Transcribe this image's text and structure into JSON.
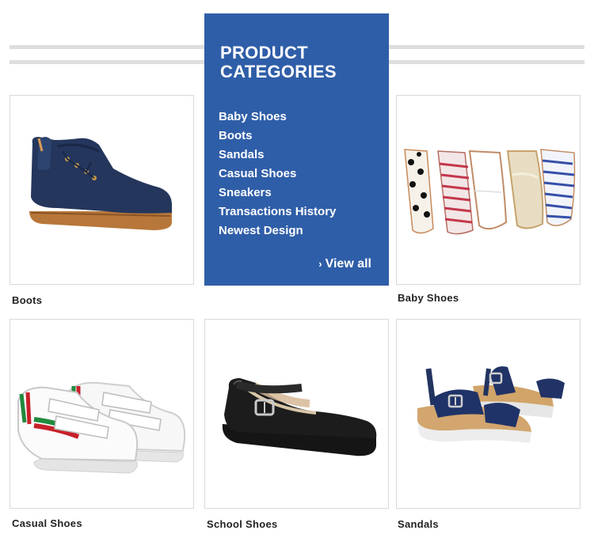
{
  "panel": {
    "title_line1": "PRODUCT",
    "title_line2": "CATEGORIES",
    "links": [
      "Baby Shoes",
      "Boots",
      "Sandals",
      "Casual Shoes",
      "Sneakers",
      "Transactions History",
      "Newest Design"
    ],
    "view_all": "View all",
    "background": "#2f5ea8"
  },
  "tiles": [
    {
      "caption": "Boots",
      "image": "navy-leather-boot"
    },
    {
      "caption": "Baby Shoes",
      "image": "baby-shoes-row"
    },
    {
      "caption": "Casual Shoes",
      "image": "white-velcro-sneakers"
    },
    {
      "caption": "School Shoes",
      "image": "black-mary-jane-shoe"
    },
    {
      "caption": "Sandals",
      "image": "navy-cork-sandals"
    }
  ]
}
